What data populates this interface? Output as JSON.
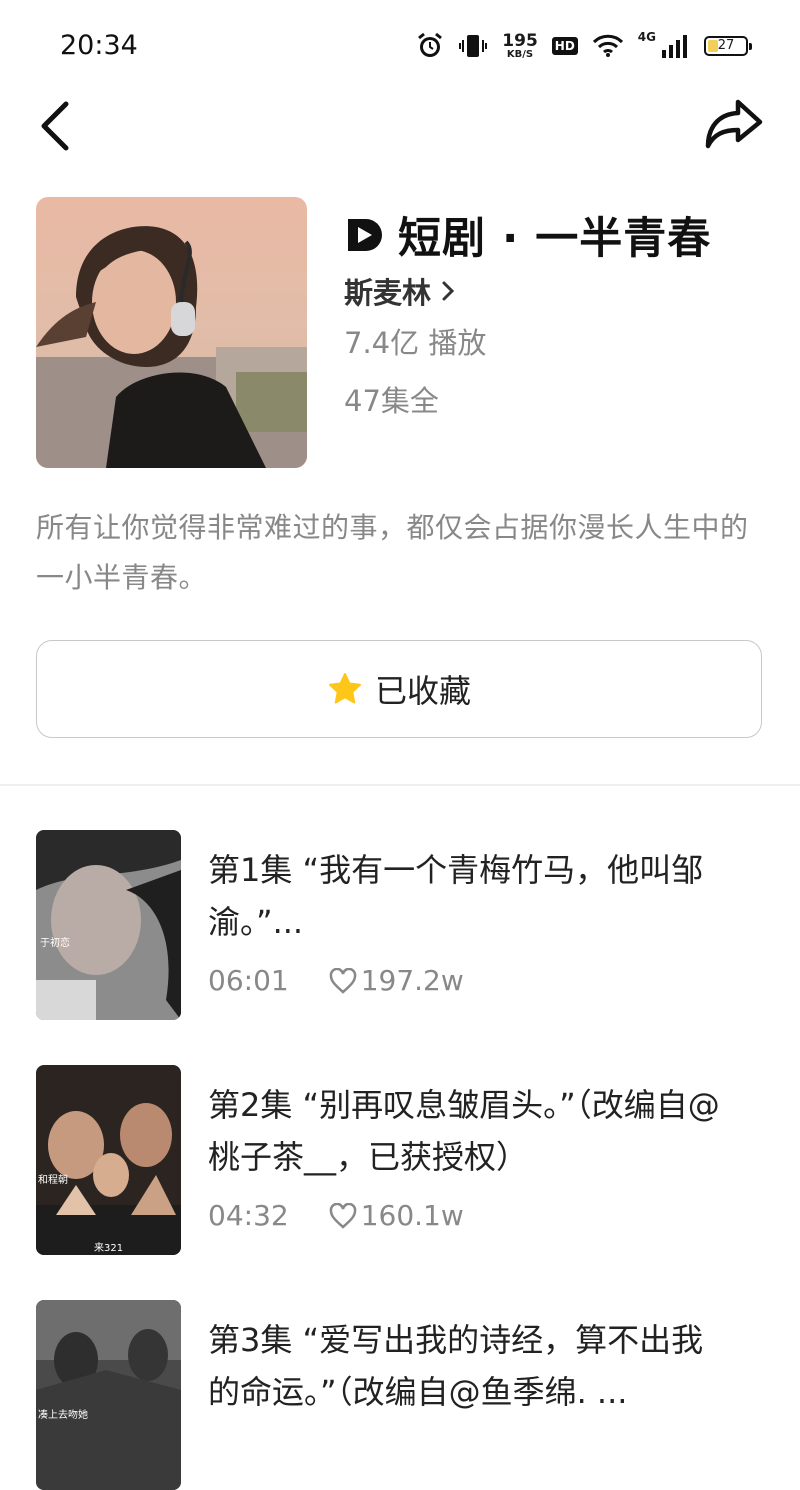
{
  "status_bar": {
    "time": "20:34",
    "net_speed_value": "195",
    "net_speed_unit": "KB/S",
    "hd_label": "HD",
    "network_label": "4G",
    "battery_level": "27"
  },
  "nav": {
    "back_icon": "chevron-left-icon",
    "share_icon": "share-arrow-icon"
  },
  "drama": {
    "logo_icon": "play-logo-icon",
    "title": "短剧 · 一半青春",
    "author": "斯麦林",
    "plays": "7.4亿 播放",
    "episodes_total": "47集全",
    "description": "所有让你觉得非常难过的事，都仅会占据你漫长人生中的一小半青春。"
  },
  "favorite": {
    "label": "已收藏",
    "icon": "star-icon",
    "icon_color": "#FFC61A"
  },
  "episodes": [
    {
      "title": "第1集 “我有一个青梅竹马，他叫邹渝。”...",
      "duration": "06:01",
      "likes": "197.2w",
      "thumb_caption": "于初恋"
    },
    {
      "title": "第2集 “别再叹息皱眉头。”（改编自@桃子茶__，已获授权）",
      "duration": "04:32",
      "likes": "160.1w",
      "thumb_caption": "和程朝",
      "thumb_caption_2": "来321"
    },
    {
      "title": "第3集 “爱写出我的诗经，算不出我的命运。”（改编自@鱼季绵. ...",
      "duration": "",
      "likes": "",
      "thumb_caption": "凑上去吻她"
    }
  ]
}
